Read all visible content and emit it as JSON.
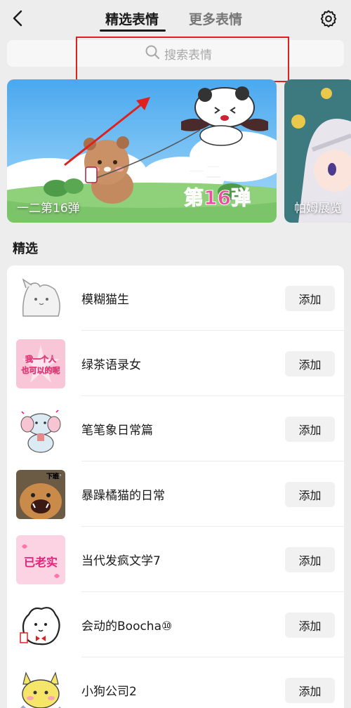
{
  "nav": {
    "tabs": [
      {
        "label": "精选表情",
        "active": true
      },
      {
        "label": "更多表情",
        "active": false
      }
    ]
  },
  "search": {
    "placeholder": "搜索表情"
  },
  "banners": [
    {
      "title": "一二第16弹",
      "art_text_top": "一二",
      "art_text_bottom": "第16弹"
    },
    {
      "title": "帕姆展览"
    }
  ],
  "section": {
    "title": "精选"
  },
  "stickers": [
    {
      "name": "模糊猫生",
      "add_label": "添加",
      "thumb_icon": "blurry-cat-icon"
    },
    {
      "name": "绿茶语录女",
      "add_label": "添加",
      "thumb_icon": "green-tea-quote-icon",
      "thumb_text": [
        "我一个人",
        "也可以的呢"
      ]
    },
    {
      "name": "笔笔象日常篇",
      "add_label": "添加",
      "thumb_icon": "elephant-icon"
    },
    {
      "name": "暴躁橘猫的日常",
      "add_label": "添加",
      "thumb_icon": "orange-cat-icon",
      "thumb_text": [
        "下班!"
      ]
    },
    {
      "name": "当代发疯文学7",
      "add_label": "添加",
      "thumb_icon": "crazy-literature-icon",
      "thumb_text": [
        "已老实"
      ]
    },
    {
      "name": "会动的Boocha⑩",
      "add_label": "添加",
      "thumb_icon": "boocha-dog-icon"
    },
    {
      "name": "小狗公司2",
      "add_label": "添加",
      "thumb_icon": "puppy-company-icon"
    }
  ],
  "colors": {
    "accent": "#e0201c",
    "background": "#ededed",
    "card": "#ffffff",
    "button": "#f1f1f1"
  }
}
